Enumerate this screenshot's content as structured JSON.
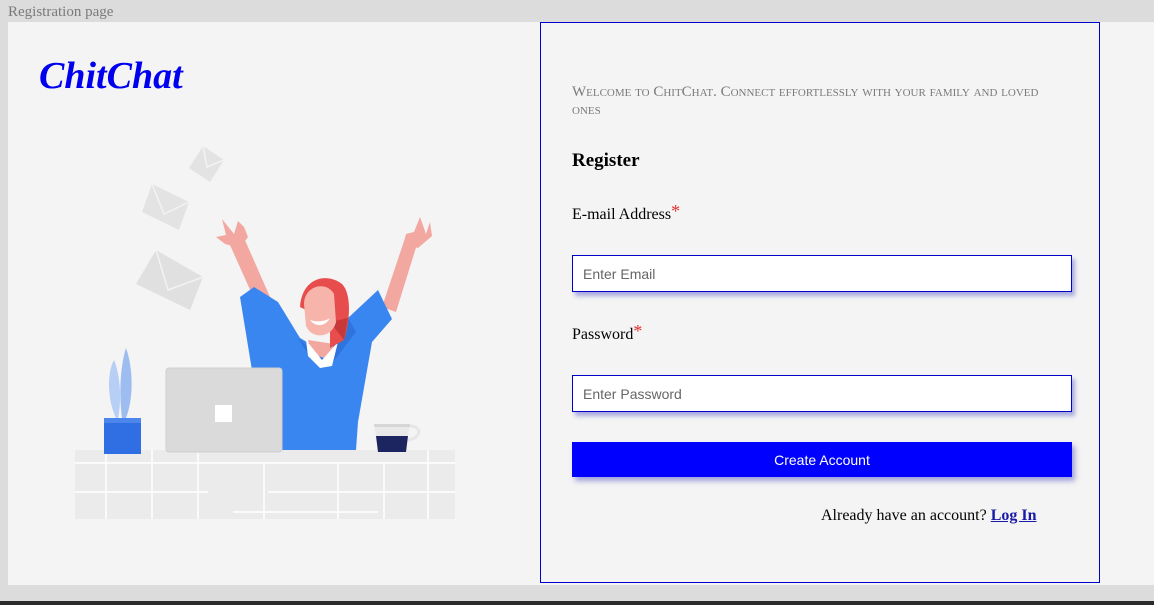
{
  "window": {
    "title": "Registration page"
  },
  "brand": {
    "name": "ChitChat"
  },
  "illustration": {
    "name": "celebrating-woman-with-laptop"
  },
  "form": {
    "welcome": "Welcome to ChitChat. Connect effortlessly with your family and loved ones",
    "heading": "Register",
    "email": {
      "label": "E-mail Address",
      "required_mark": "*",
      "placeholder": "Enter Email",
      "value": ""
    },
    "password": {
      "label": "Password",
      "required_mark": "*",
      "placeholder": "Enter Password",
      "value": ""
    },
    "submit_label": "Create Account",
    "login_prompt": "Already have an account?",
    "login_link": "Log In"
  },
  "colors": {
    "accent": "#0000ff",
    "brand": "#0000ee",
    "required": "#e03030",
    "panel_border": "#0000cc"
  }
}
